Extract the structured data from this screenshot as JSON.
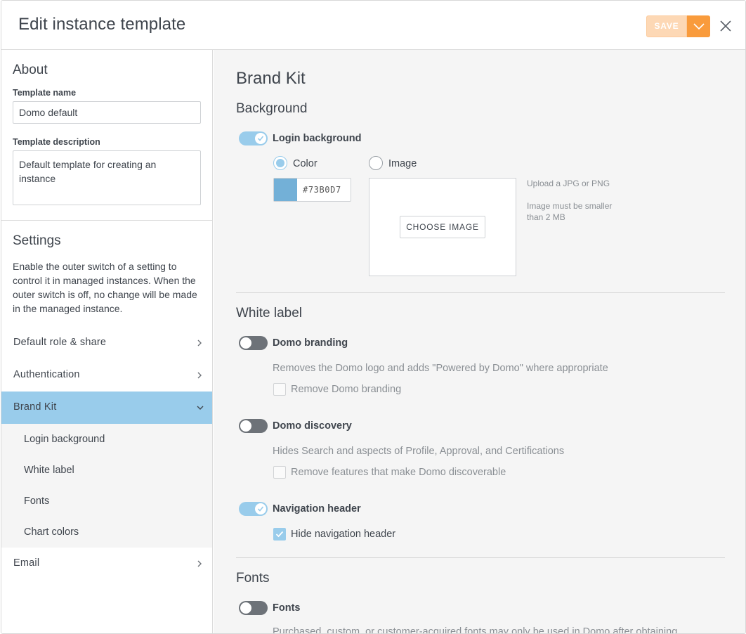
{
  "header": {
    "title": "Edit instance template",
    "save_label": "SAVE",
    "save_color": "#fdd8b5",
    "accent_color": "#f99b3c",
    "close_icon": "close-icon"
  },
  "sidebar": {
    "about_title": "About",
    "template_name_label": "Template name",
    "template_name_value": "Domo default",
    "template_desc_label": "Template description",
    "template_desc_value": "Default template for creating an instance",
    "settings_title": "Settings",
    "settings_desc": "Enable the outer switch of a setting to control it in managed instances. When the outer switch is off, no change will be made in the managed instance.",
    "nav": [
      {
        "label": "Default role & share",
        "icon": "chevron-right-icon"
      },
      {
        "label": "Authentication",
        "icon": "chevron-right-icon"
      },
      {
        "label": "Brand Kit",
        "icon": "chevron-down-icon",
        "active": true
      },
      {
        "label": "Email",
        "icon": "chevron-right-icon"
      }
    ],
    "sub_nav": [
      "Login background",
      "White label",
      "Fonts",
      "Chart colors"
    ],
    "active_color": "#99cceb"
  },
  "main": {
    "title": "Brand Kit",
    "background": {
      "heading": "Background",
      "toggle_label": "Login background",
      "toggle_on": true,
      "radio_color_label": "Color",
      "radio_image_label": "Image",
      "color_hex": "#73B0D7",
      "choose_image_label": "CHOOSE IMAGE",
      "hint_1": "Upload a JPG or PNG",
      "hint_2": "Image must be smaller",
      "hint_3": "than 2 MB"
    },
    "white_label": {
      "heading": "White label",
      "branding_label": "Domo branding",
      "branding_on": false,
      "branding_help": "Removes the Domo logo and adds \"Powered by Domo\" where appropriate",
      "branding_check": "Remove Domo branding",
      "discovery_label": "Domo discovery",
      "discovery_on": false,
      "discovery_help": "Hides Search and aspects of Profile, Approval, and Certifications",
      "discovery_check": "Remove features that make Domo discoverable",
      "nav_header_label": "Navigation header",
      "nav_header_on": true,
      "nav_header_check": "Hide navigation header",
      "nav_header_checked": true
    },
    "fonts": {
      "heading": "Fonts",
      "toggle_label": "Fonts",
      "toggle_on": false,
      "help": "Purchased, custom, or customer-acquired fonts may only be used in Domo after obtaining"
    }
  }
}
